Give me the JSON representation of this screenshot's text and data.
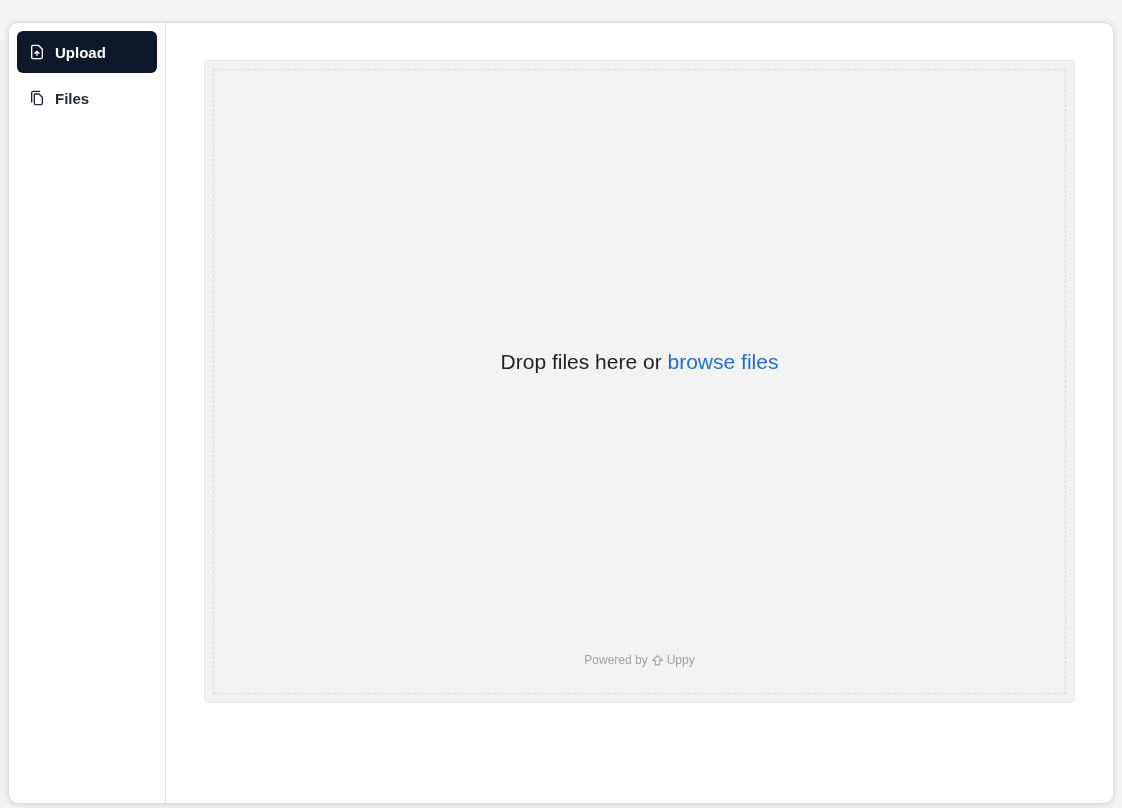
{
  "sidebar": {
    "items": [
      {
        "label": "Upload",
        "kind": "upload",
        "selected": true
      },
      {
        "label": "Files",
        "kind": "files",
        "selected": false
      }
    ]
  },
  "dropzone": {
    "prompt": "Drop files here or",
    "link": "browse files",
    "footer": "Powered by",
    "brand": "Uppy"
  }
}
